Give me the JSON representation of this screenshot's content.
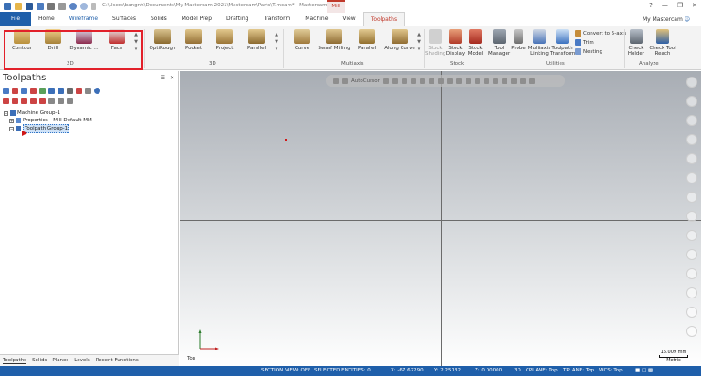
{
  "window": {
    "title": "C:\\Users\\bangnh\\Documents\\My Mastercam 2021\\Mastercam\\Parts\\T.mcam* - Mastercam",
    "context_tab": "Mill",
    "controls": [
      "?",
      "—",
      "❐",
      "✕"
    ]
  },
  "tabs": [
    {
      "label": "File"
    },
    {
      "label": "Home"
    },
    {
      "label": "Wireframe"
    },
    {
      "label": "Surfaces"
    },
    {
      "label": "Solids"
    },
    {
      "label": "Model Prep"
    },
    {
      "label": "Drafting"
    },
    {
      "label": "Transform"
    },
    {
      "label": "Machine"
    },
    {
      "label": "View"
    },
    {
      "label": "Toolpaths"
    }
  ],
  "account": "My Mastercam",
  "ribbon": {
    "group_2d": {
      "label": "2D",
      "buttons": [
        {
          "label": "Contour"
        },
        {
          "label": "Drill"
        },
        {
          "label": "Dynamic ..."
        },
        {
          "label": "Face"
        }
      ]
    },
    "group_3d": {
      "label": "3D",
      "buttons": [
        {
          "label": "OptiRough"
        },
        {
          "label": "Pocket"
        },
        {
          "label": "Project"
        },
        {
          "label": "Parallel"
        }
      ]
    },
    "group_multiaxis": {
      "label": "Multiaxis",
      "buttons": [
        {
          "label": "Curve"
        },
        {
          "label": "Swarf Milling"
        },
        {
          "label": "Parallel"
        },
        {
          "label": "Along Curve"
        }
      ]
    },
    "group_stock": {
      "label": "Stock",
      "buttons": [
        {
          "label": "Stock Shading"
        },
        {
          "label": "Stock Display"
        },
        {
          "label": "Stock Model"
        }
      ]
    },
    "group_utilities": {
      "label": "Utilities",
      "buttons": [
        {
          "label": "Tool Manager"
        },
        {
          "label": "Probe"
        },
        {
          "label": "Multiaxis Linking"
        },
        {
          "label": "Toolpath Transform"
        }
      ],
      "small": [
        {
          "label": "Convert to 5-axis"
        },
        {
          "label": "Trim"
        },
        {
          "label": "Nesting"
        }
      ]
    },
    "group_analyze": {
      "label": "Analyze",
      "buttons": [
        {
          "label": "Check Holder"
        },
        {
          "label": "Check Tool Reach"
        }
      ]
    }
  },
  "panel": {
    "title": "Toolpaths",
    "tree": [
      {
        "label": "Machine Group-1"
      },
      {
        "label": "Properties - Mill Default MM"
      },
      {
        "label": "Toolpath Group-1"
      }
    ],
    "bottom_tabs": [
      "Toolpaths",
      "Solids",
      "Planes",
      "Levels",
      "Recent Functions"
    ]
  },
  "viewport": {
    "toolbar_label": "AutoCursor",
    "view_name": "Top",
    "scale_value": "16.009 mm",
    "scale_unit": "Metric"
  },
  "status": {
    "section_view": "SECTION VIEW: OFF",
    "selected": "SELECTED ENTITIES: 0",
    "x": "X:  -67.62290",
    "y": "Y:  2.25132",
    "z": "Z:  0.00000",
    "mode": "3D",
    "cplane": "CPLANE: Top",
    "tplane": "TPLANE: Top",
    "wcs": "WCS: Top"
  },
  "colors": {
    "accent": "#1f5faa",
    "highlight": "#e2202a",
    "active_tab": "#c0392b"
  }
}
